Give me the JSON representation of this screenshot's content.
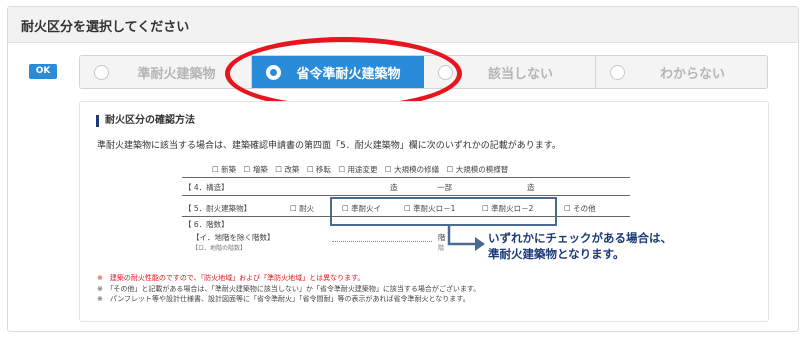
{
  "panel": {
    "title": "耐火区分を選択してください"
  },
  "status_badge": "OK",
  "options": [
    {
      "label": "準耐火建築物",
      "selected": false
    },
    {
      "label": "省令準耐火建築物",
      "selected": true
    },
    {
      "label": "該当しない",
      "selected": false
    },
    {
      "label": "わからない",
      "selected": false
    }
  ],
  "colors": {
    "accent": "#2a8cd8",
    "highlight": "#e8141e",
    "navy": "#1d3a78"
  },
  "info": {
    "title": "耐火区分の確認方法",
    "description": "準耐火建築物に該当する場合は、建築確認申請書の第四面「5．耐火建築物」欄に次のいずれかの記載があります。",
    "form": {
      "row0": "☐ 新築　☐ 増築　☐ 改築　☐ 移転　☐ 用途変更　☐ 大規模の修繕　☐ 大規模の模様替",
      "row1_label": "【 4．構造】",
      "row1_a": "造",
      "row1_b": "一部",
      "row1_c": "造",
      "row2_label": "【 5．耐火建築物】",
      "row2_opt0": "☐ 耐火",
      "row2_opt1": "☐ 準耐火イ",
      "row2_opt2": "☐ 準耐火ロ－1",
      "row2_opt3": "☐ 準耐火ロ－2",
      "row2_opt4": "☐ その他",
      "row3_label": "【 6．階数】",
      "row4_label": "【イ．地階を除く階数】",
      "row4_unit": "階",
      "row5_label": "【ロ．地階の階数】",
      "row5_unit": "階"
    },
    "callout_line1": "いずれかにチェックがある場合は、",
    "callout_line2": "準耐火建築物となります。",
    "notes": [
      "※　建築の耐火性能のですので、「防火地域」および「準防火地域」とは異なります。",
      "※　「その他」と記載がある場合は、「準耐火建築物に該当しない」か「省令準耐火建築物」に該当する場合がございます。",
      "※　パンフレット等や設計仕様書、設計図面等に「省令準耐火」「省令間耐」等の表示があれば省令準耐火となります。"
    ]
  }
}
